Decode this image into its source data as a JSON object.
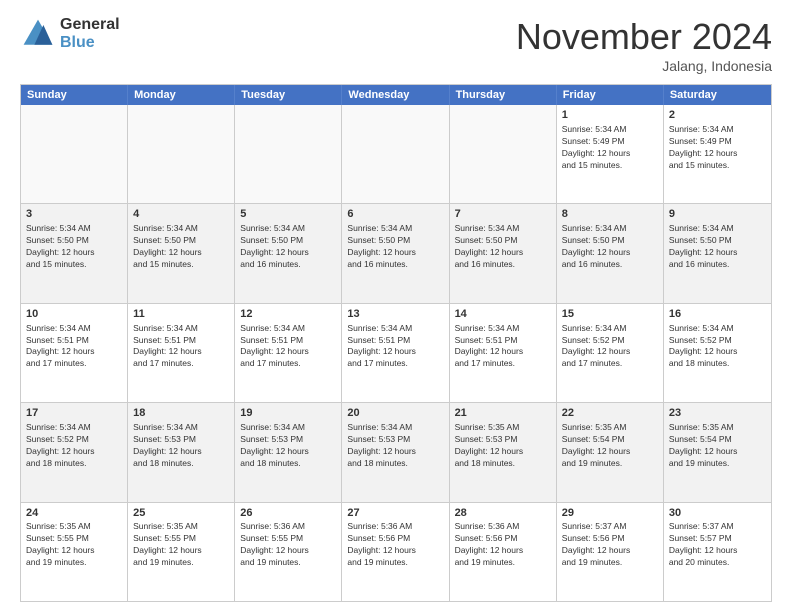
{
  "logo": {
    "general": "General",
    "blue": "Blue"
  },
  "header": {
    "month": "November 2024",
    "location": "Jalang, Indonesia"
  },
  "days": [
    "Sunday",
    "Monday",
    "Tuesday",
    "Wednesday",
    "Thursday",
    "Friday",
    "Saturday"
  ],
  "weeks": [
    [
      {
        "day": "",
        "detail": ""
      },
      {
        "day": "",
        "detail": ""
      },
      {
        "day": "",
        "detail": ""
      },
      {
        "day": "",
        "detail": ""
      },
      {
        "day": "",
        "detail": ""
      },
      {
        "day": "1",
        "detail": "Sunrise: 5:34 AM\nSunset: 5:49 PM\nDaylight: 12 hours\nand 15 minutes."
      },
      {
        "day": "2",
        "detail": "Sunrise: 5:34 AM\nSunset: 5:49 PM\nDaylight: 12 hours\nand 15 minutes."
      }
    ],
    [
      {
        "day": "3",
        "detail": "Sunrise: 5:34 AM\nSunset: 5:50 PM\nDaylight: 12 hours\nand 15 minutes."
      },
      {
        "day": "4",
        "detail": "Sunrise: 5:34 AM\nSunset: 5:50 PM\nDaylight: 12 hours\nand 15 minutes."
      },
      {
        "day": "5",
        "detail": "Sunrise: 5:34 AM\nSunset: 5:50 PM\nDaylight: 12 hours\nand 16 minutes."
      },
      {
        "day": "6",
        "detail": "Sunrise: 5:34 AM\nSunset: 5:50 PM\nDaylight: 12 hours\nand 16 minutes."
      },
      {
        "day": "7",
        "detail": "Sunrise: 5:34 AM\nSunset: 5:50 PM\nDaylight: 12 hours\nand 16 minutes."
      },
      {
        "day": "8",
        "detail": "Sunrise: 5:34 AM\nSunset: 5:50 PM\nDaylight: 12 hours\nand 16 minutes."
      },
      {
        "day": "9",
        "detail": "Sunrise: 5:34 AM\nSunset: 5:50 PM\nDaylight: 12 hours\nand 16 minutes."
      }
    ],
    [
      {
        "day": "10",
        "detail": "Sunrise: 5:34 AM\nSunset: 5:51 PM\nDaylight: 12 hours\nand 17 minutes."
      },
      {
        "day": "11",
        "detail": "Sunrise: 5:34 AM\nSunset: 5:51 PM\nDaylight: 12 hours\nand 17 minutes."
      },
      {
        "day": "12",
        "detail": "Sunrise: 5:34 AM\nSunset: 5:51 PM\nDaylight: 12 hours\nand 17 minutes."
      },
      {
        "day": "13",
        "detail": "Sunrise: 5:34 AM\nSunset: 5:51 PM\nDaylight: 12 hours\nand 17 minutes."
      },
      {
        "day": "14",
        "detail": "Sunrise: 5:34 AM\nSunset: 5:51 PM\nDaylight: 12 hours\nand 17 minutes."
      },
      {
        "day": "15",
        "detail": "Sunrise: 5:34 AM\nSunset: 5:52 PM\nDaylight: 12 hours\nand 17 minutes."
      },
      {
        "day": "16",
        "detail": "Sunrise: 5:34 AM\nSunset: 5:52 PM\nDaylight: 12 hours\nand 18 minutes."
      }
    ],
    [
      {
        "day": "17",
        "detail": "Sunrise: 5:34 AM\nSunset: 5:52 PM\nDaylight: 12 hours\nand 18 minutes."
      },
      {
        "day": "18",
        "detail": "Sunrise: 5:34 AM\nSunset: 5:53 PM\nDaylight: 12 hours\nand 18 minutes."
      },
      {
        "day": "19",
        "detail": "Sunrise: 5:34 AM\nSunset: 5:53 PM\nDaylight: 12 hours\nand 18 minutes."
      },
      {
        "day": "20",
        "detail": "Sunrise: 5:34 AM\nSunset: 5:53 PM\nDaylight: 12 hours\nand 18 minutes."
      },
      {
        "day": "21",
        "detail": "Sunrise: 5:35 AM\nSunset: 5:53 PM\nDaylight: 12 hours\nand 18 minutes."
      },
      {
        "day": "22",
        "detail": "Sunrise: 5:35 AM\nSunset: 5:54 PM\nDaylight: 12 hours\nand 19 minutes."
      },
      {
        "day": "23",
        "detail": "Sunrise: 5:35 AM\nSunset: 5:54 PM\nDaylight: 12 hours\nand 19 minutes."
      }
    ],
    [
      {
        "day": "24",
        "detail": "Sunrise: 5:35 AM\nSunset: 5:55 PM\nDaylight: 12 hours\nand 19 minutes."
      },
      {
        "day": "25",
        "detail": "Sunrise: 5:35 AM\nSunset: 5:55 PM\nDaylight: 12 hours\nand 19 minutes."
      },
      {
        "day": "26",
        "detail": "Sunrise: 5:36 AM\nSunset: 5:55 PM\nDaylight: 12 hours\nand 19 minutes."
      },
      {
        "day": "27",
        "detail": "Sunrise: 5:36 AM\nSunset: 5:56 PM\nDaylight: 12 hours\nand 19 minutes."
      },
      {
        "day": "28",
        "detail": "Sunrise: 5:36 AM\nSunset: 5:56 PM\nDaylight: 12 hours\nand 19 minutes."
      },
      {
        "day": "29",
        "detail": "Sunrise: 5:37 AM\nSunset: 5:56 PM\nDaylight: 12 hours\nand 19 minutes."
      },
      {
        "day": "30",
        "detail": "Sunrise: 5:37 AM\nSunset: 5:57 PM\nDaylight: 12 hours\nand 20 minutes."
      }
    ]
  ]
}
